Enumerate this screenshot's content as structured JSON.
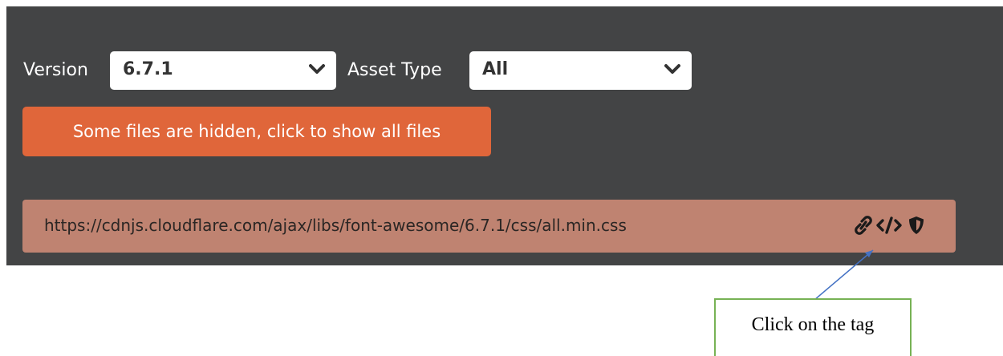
{
  "filters": {
    "version_label": "Version",
    "version_value": "6.7.1",
    "asset_type_label": "Asset Type",
    "asset_type_value": "All"
  },
  "notice_button": "Some files are hidden, click to show all files",
  "file": {
    "url": "https://cdnjs.cloudflare.com/ajax/libs/font-awesome/6.7.1/css/all.min.css",
    "icons": [
      "link-icon",
      "code-tag-icon",
      "shield-icon"
    ]
  },
  "annotation": {
    "text": "Click on the tag"
  },
  "colors": {
    "panel_bg": "#434445",
    "button_orange": "#e0663a",
    "file_row_bg": "#bf8371",
    "callout_border": "#77b255",
    "arrow": "#4472c4"
  }
}
